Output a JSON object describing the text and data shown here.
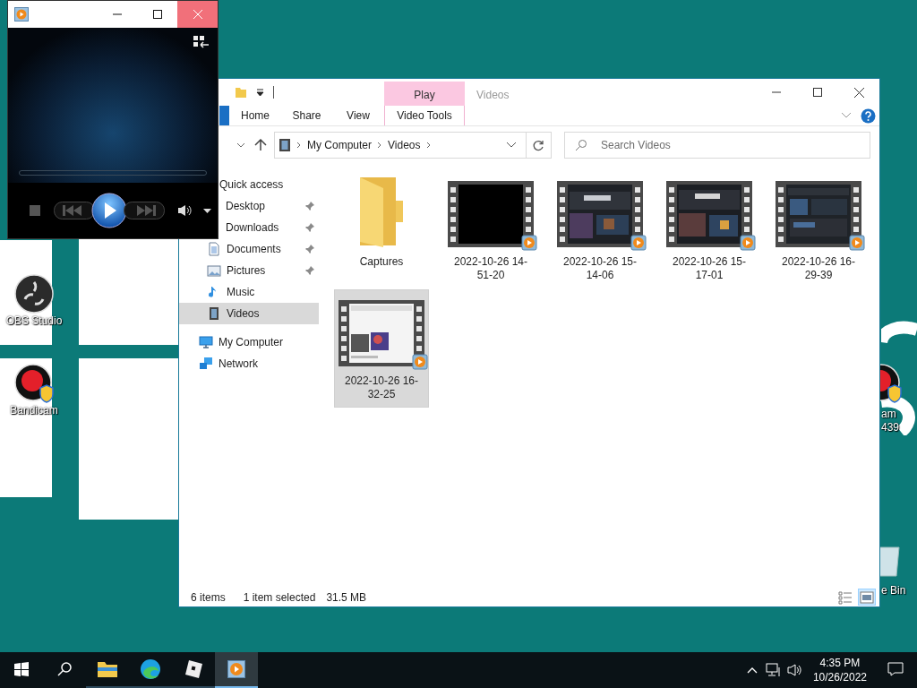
{
  "desktop": {
    "icons": [
      {
        "kind": "obs",
        "lines": [
          "OBS Studio"
        ]
      },
      {
        "kind": "bandicam",
        "lines": [
          "Bandicam"
        ]
      }
    ],
    "edge_icons": [
      {
        "kind": "bandicam",
        "lines": [
          "am",
          "439"
        ]
      },
      {
        "kind": "recycle",
        "lines": [
          "e Bin"
        ]
      }
    ]
  },
  "media_player": {
    "controls": [
      {
        "kind": "stop"
      },
      {
        "kind": "previous"
      },
      {
        "kind": "play"
      },
      {
        "kind": "next"
      },
      {
        "kind": "volume"
      },
      {
        "kind": "menu"
      }
    ]
  },
  "explorer": {
    "title": "Videos",
    "context_tab_group": "Play",
    "ribbon_tabs": [
      {
        "label": "Home",
        "kind": "standard",
        "selected": false
      },
      {
        "label": "Share",
        "kind": "standard",
        "selected": false
      },
      {
        "label": "View",
        "kind": "standard",
        "selected": false
      },
      {
        "label": "Video Tools",
        "kind": "contextual",
        "selected": false
      }
    ],
    "address": [
      "My Computer",
      "Videos"
    ],
    "search": {
      "placeholder": "Search Videos"
    },
    "navigation": [
      {
        "label": "Quick access",
        "selected": false,
        "children": [
          {
            "label": "Desktop",
            "pinned": true,
            "selected": false
          },
          {
            "label": "Downloads",
            "pinned": true,
            "selected": false
          },
          {
            "label": "Documents",
            "kind": "documents",
            "pinned": true,
            "selected": false
          },
          {
            "label": "Pictures",
            "kind": "pictures",
            "pinned": true,
            "selected": false
          },
          {
            "label": "Music",
            "kind": "music",
            "pinned": false,
            "selected": false
          },
          {
            "label": "Videos",
            "kind": "videos",
            "pinned": false,
            "selected": true
          }
        ]
      },
      {
        "label": "My Computer",
        "kind": "computer",
        "selected": false
      },
      {
        "label": "Network",
        "kind": "network",
        "selected": false
      }
    ],
    "items": [
      {
        "name": "Captures",
        "kind": "folder",
        "selected": false
      },
      {
        "name": "2022-10-26 14-51-20",
        "kind": "video",
        "selected": false
      },
      {
        "name": "2022-10-26 15-14-06",
        "kind": "video",
        "selected": false
      },
      {
        "name": "2022-10-26 15-17-01",
        "kind": "video",
        "selected": false
      },
      {
        "name": "2022-10-26 16-29-39",
        "kind": "video",
        "selected": false
      },
      {
        "name": "2022-10-26 16-32-25",
        "kind": "video",
        "selected": true
      }
    ],
    "status": {
      "count": "6 items",
      "selection": "1 item selected",
      "size": "31.5 MB"
    },
    "view_modes": [
      {
        "kind": "details",
        "selected": false
      },
      {
        "kind": "large-icons",
        "selected": true
      }
    ]
  },
  "taskbar": {
    "apps": [
      {
        "kind": "explorer",
        "active": false
      },
      {
        "kind": "edge",
        "active": false
      },
      {
        "kind": "roblox",
        "active": false
      },
      {
        "kind": "player",
        "active": true
      }
    ],
    "time": "4:35 PM",
    "date": "10/26/2022"
  }
}
